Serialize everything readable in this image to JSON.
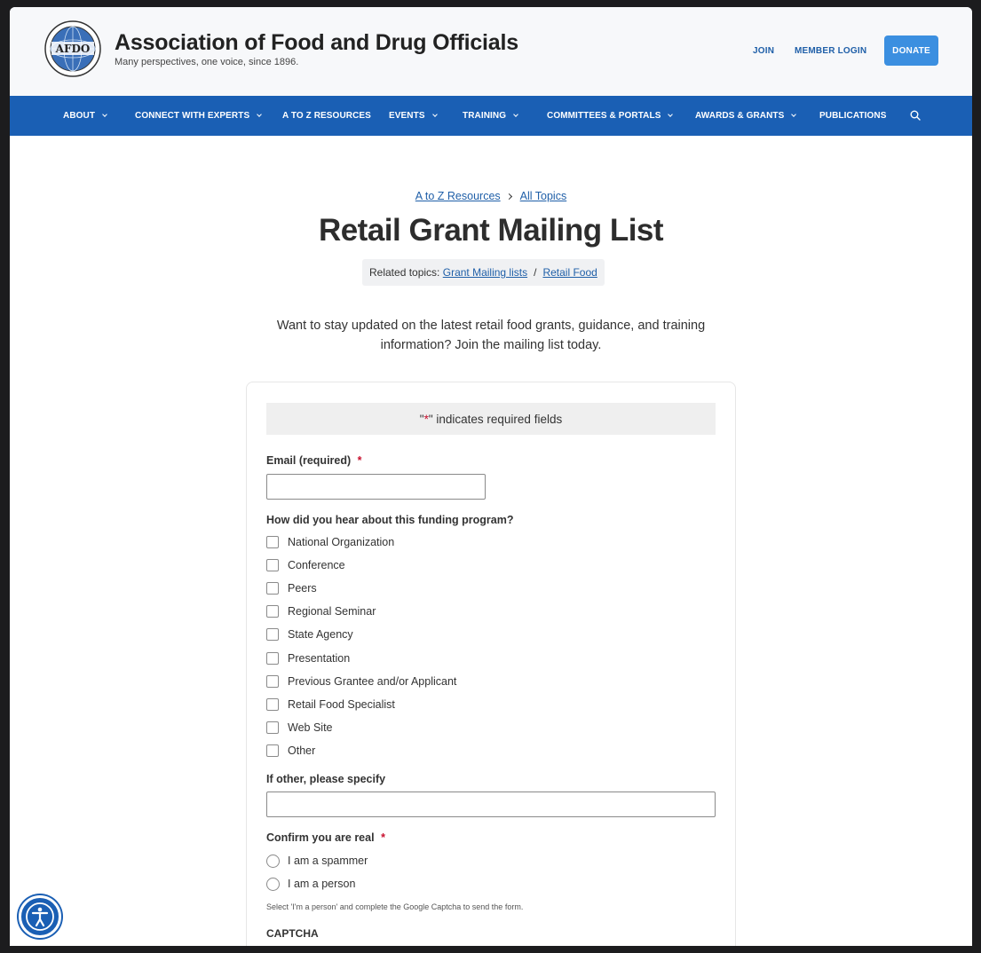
{
  "header": {
    "site_name": "Association of Food and Drug Officials",
    "tagline": "Many perspectives, one voice, since 1896.",
    "logo_text": "AFDO",
    "join": "JOIN",
    "member_login": "MEMBER LOGIN",
    "donate": "DONATE"
  },
  "nav": {
    "items": [
      {
        "label": "ABOUT"
      },
      {
        "label": "CONNECT WITH EXPERTS"
      },
      {
        "label": "A TO Z RESOURCES"
      },
      {
        "label": "EVENTS"
      },
      {
        "label": "TRAINING"
      },
      {
        "label": "COMMITTEES & PORTALS"
      },
      {
        "label": "AWARDS & GRANTS"
      },
      {
        "label": "PUBLICATIONS"
      }
    ]
  },
  "breadcrumb": {
    "first": "A to Z Resources",
    "second": "All Topics"
  },
  "page": {
    "title": "Retail Grant Mailing List",
    "related_label": "Related topics:",
    "related_1": "Grant Mailing lists",
    "related_sep": "/",
    "related_2": "Retail Food",
    "intro": "Want to stay updated on the latest retail food grants, guidance, and training information? Join the mailing list today."
  },
  "form": {
    "req_quote_open": "\"",
    "req_star": "*",
    "req_quote_close": "\"",
    "req_text": " indicates required fields",
    "email_label": "Email (required)",
    "required_star": "*",
    "email_value": "",
    "hear_label": "How did you hear about this funding program?",
    "options": [
      "National Organization",
      "Conference",
      "Peers",
      "Regional Seminar",
      "State Agency",
      "Presentation",
      "Previous Grantee and/or Applicant",
      "Retail Food Specialist",
      "Web Site",
      "Other"
    ],
    "other_label": "If other, please specify",
    "other_value": "",
    "confirm_label": "Confirm you are real",
    "radio_1": "I am a spammer",
    "radio_2": "I am a person",
    "hint": "Select 'I'm a person' and complete the Google Captcha to send the form.",
    "captcha_label": "CAPTCHA"
  },
  "colors": {
    "brand_blue": "#1a5fb4",
    "donate_blue": "#3b8fe0",
    "required_red": "#c8102e"
  },
  "icons": {
    "search": "search-icon",
    "accessibility": "accessibility-icon",
    "logo": "globe-logo-icon"
  }
}
